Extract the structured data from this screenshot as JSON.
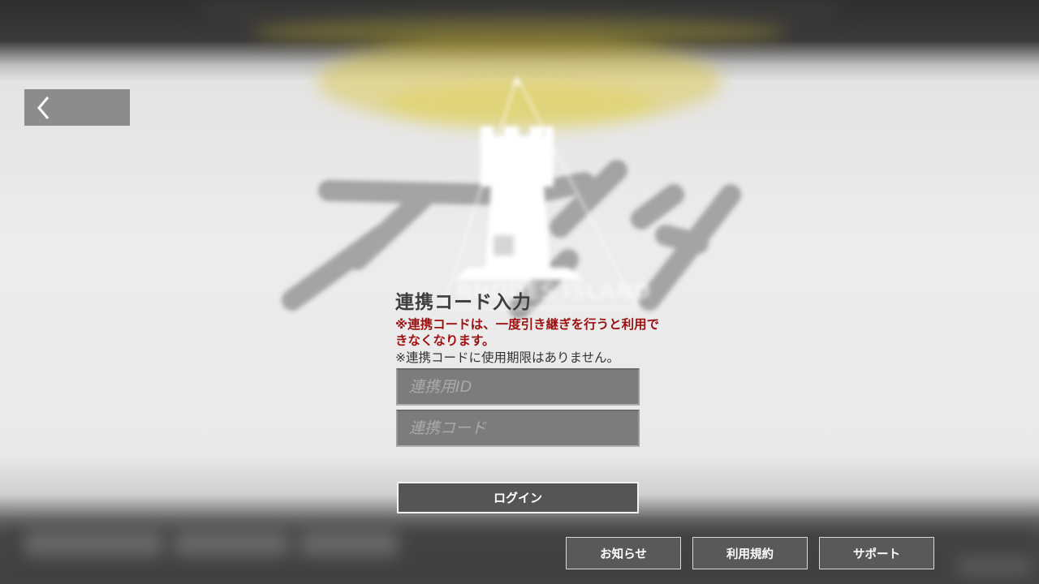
{
  "back_button": {
    "icon": "chevron-left-icon"
  },
  "background": {
    "logo_text": "RHODES ISLAND"
  },
  "panel": {
    "title": "連携コード入力",
    "warning_line1": "※連携コードは、一度引き継ぎを行うと利用で",
    "warning_line2": "きなくなります。",
    "info": "※連携コードに使用期限はありません。",
    "id_placeholder": "連携用ID",
    "id_value": "",
    "code_placeholder": "連携コード",
    "code_value": "",
    "login_label": "ログイン"
  },
  "footer": {
    "news_label": "お知らせ",
    "terms_label": "利用規約",
    "support_label": "サポート"
  },
  "colors": {
    "warning": "#9b1010",
    "button_bg": "#555555",
    "field_bg": "#7c7c7c"
  }
}
